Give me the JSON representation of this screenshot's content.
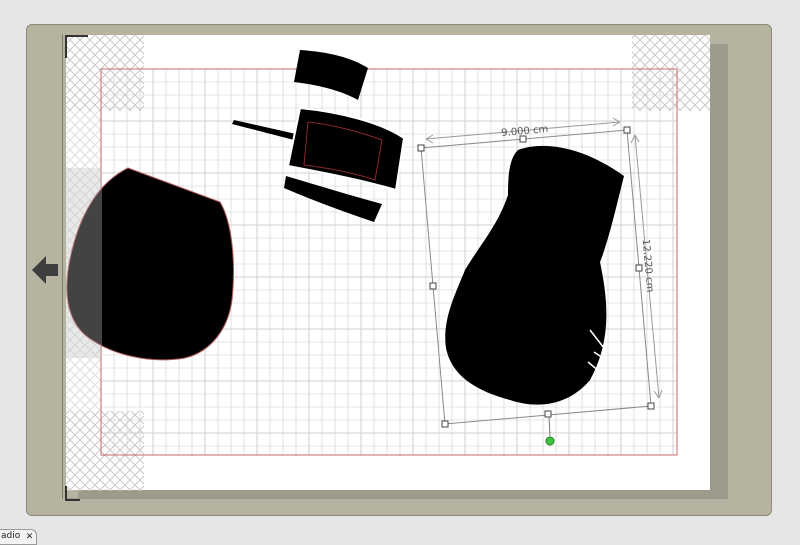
{
  "canvas": {
    "selection": {
      "width_label": "9.000 cm",
      "height_label": "12.220 cm"
    }
  },
  "colors": {
    "frame": "#b6b4a1",
    "grid": "#cfcfcf",
    "cut_border": "#c46b6b",
    "rotate_handle": "#3ec43e",
    "shape_fill": "#000000"
  },
  "icons": {
    "back": "arrow-left-icon",
    "rotate": "rotate-handle-icon",
    "close": "close-icon"
  },
  "status_tab": {
    "label": "adio"
  }
}
